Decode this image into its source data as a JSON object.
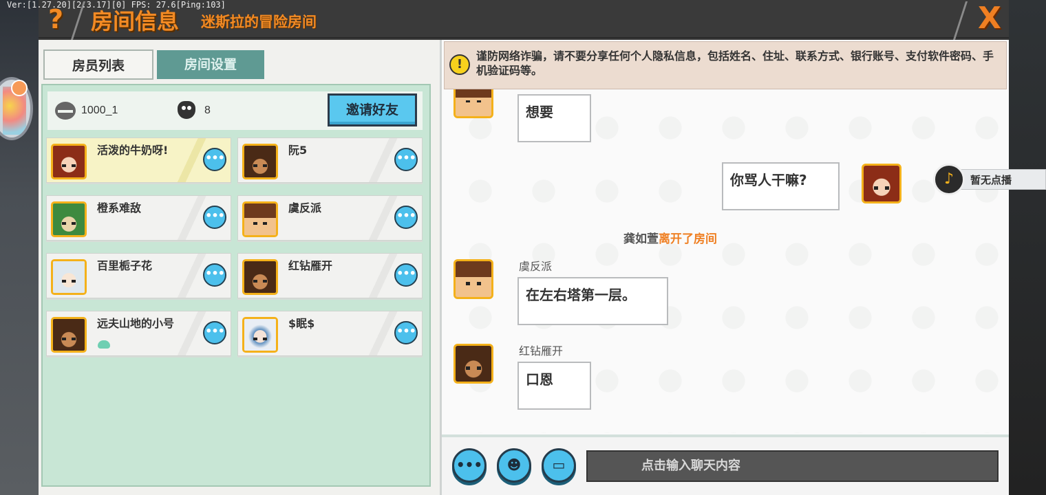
{
  "debug": "Ver:[1.27.20][2.3.17][0] FPS: 27.6[Ping:103]",
  "header": {
    "help_icon": "?",
    "title": "房间信息",
    "subtitle": "迷斯拉的冒险房间",
    "close_icon": "X"
  },
  "tabs": [
    {
      "label": "房员列表",
      "active": true
    },
    {
      "label": "房间设置",
      "active": false
    }
  ],
  "room": {
    "id": "1000_1",
    "member_count": "8",
    "invite_label": "邀请好友"
  },
  "members": [
    {
      "name": "活泼的牛奶呀!",
      "avatar": "girl-red-hair",
      "highlight": true
    },
    {
      "name": "阮5",
      "avatar": "tan-boy"
    },
    {
      "name": "橙系难敌",
      "avatar": "green-dino-hood"
    },
    {
      "name": "虞反派",
      "avatar": "brown-hair-boy"
    },
    {
      "name": "百里栀子花",
      "avatar": "white-hair"
    },
    {
      "name": "红钻雁开",
      "avatar": "headband-boy"
    },
    {
      "name": "远夫山地的小号",
      "avatar": "tan-boy",
      "badge": "cloud-icon"
    },
    {
      "name": "$眠$",
      "avatar": "fancy-girl"
    }
  ],
  "more_icon": "•••",
  "chat": {
    "warning": "谨防网络诈骗，请不要分享任何个人隐私信息，包括姓名、住址、联系方式、银行账号、支付软件密码、手机验证码等。",
    "messages": [
      {
        "sender": "",
        "text": "想要"
      },
      {
        "sender": "",
        "text": "你骂人干嘛?",
        "self": true
      },
      {
        "sender": "虞反派",
        "text": "在左右塔第一层。"
      },
      {
        "sender": "红钻雁开",
        "text": "口恩"
      }
    ],
    "system": {
      "user": "龚如萱",
      "action": "离开了房间"
    },
    "music_label": "暂无点播",
    "input_placeholder": "点击输入聊天内容",
    "bottom_buttons": [
      "more-icon",
      "emoji-icon",
      "keyboard-icon"
    ]
  },
  "colors": {
    "accent_orange": "#f28a24",
    "button_blue": "#4cc0ec",
    "panel_green": "#c8e6d5",
    "tab_teal": "#5f9a93"
  }
}
